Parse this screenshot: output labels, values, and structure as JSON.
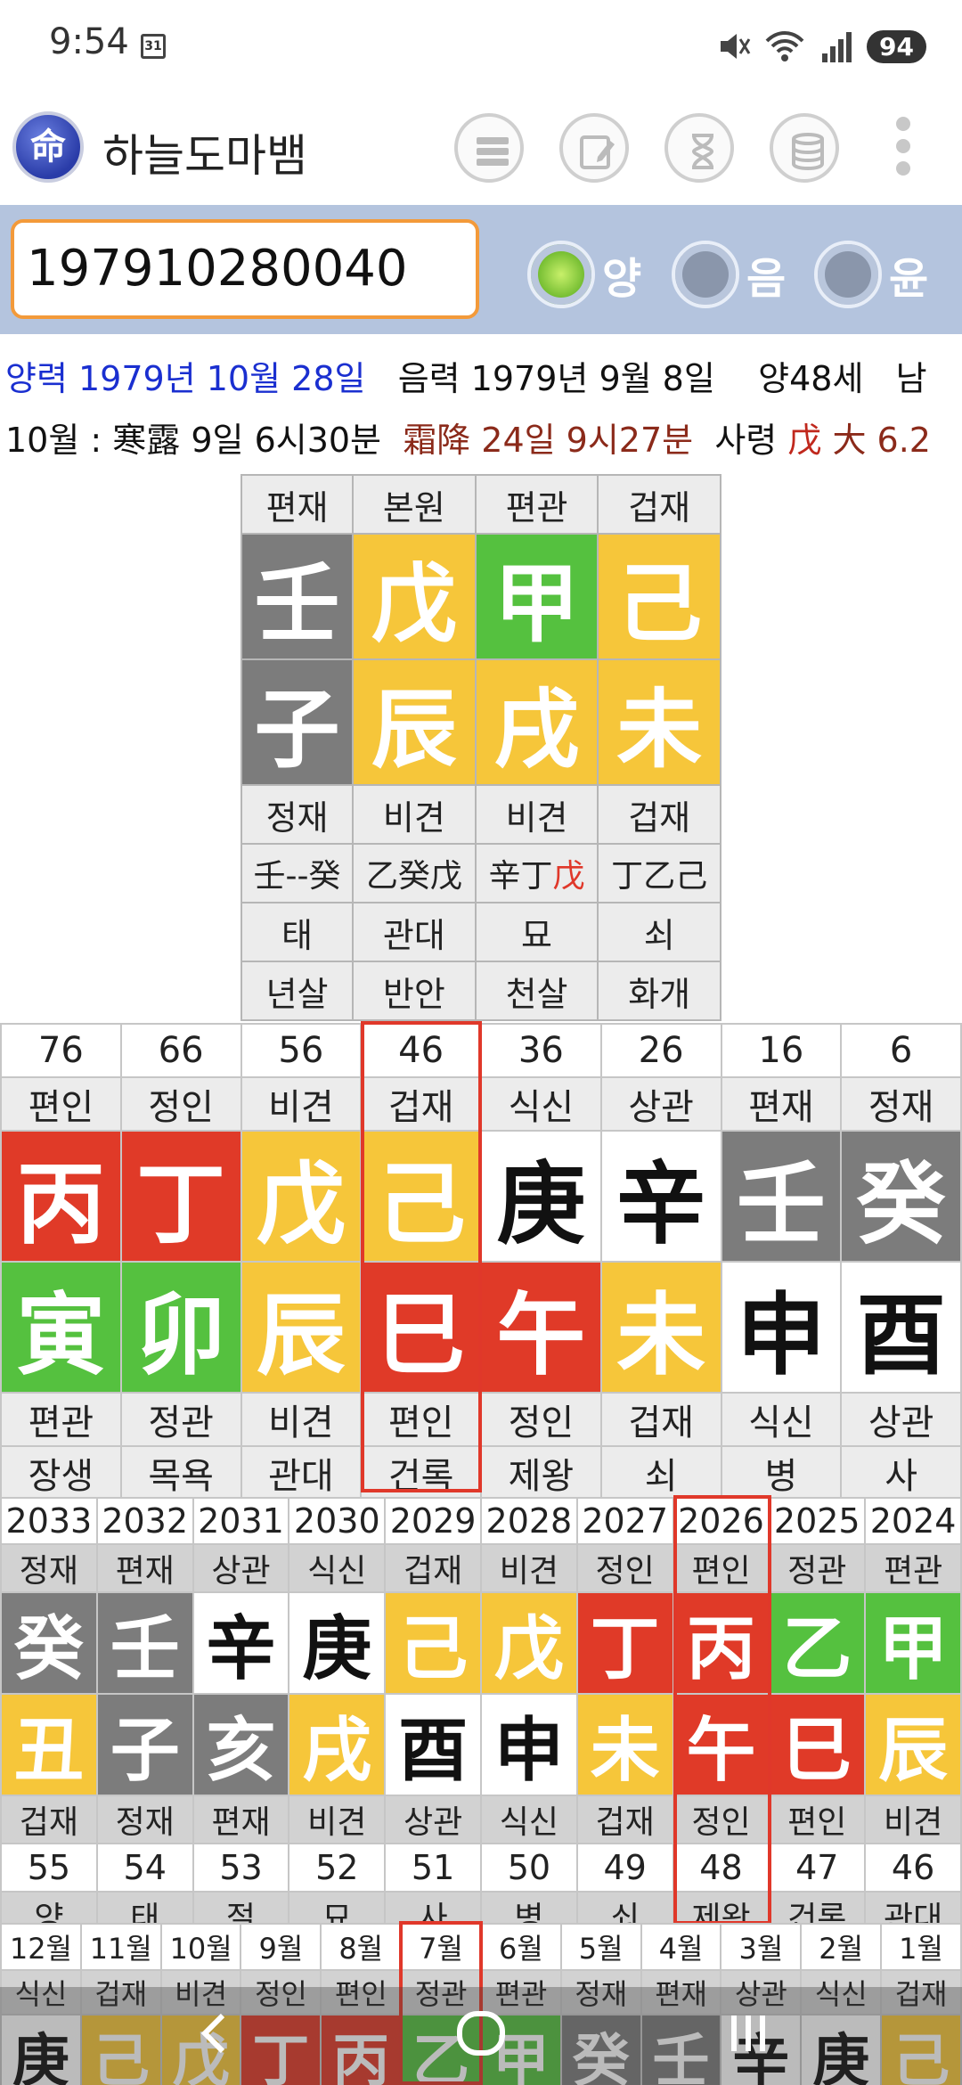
{
  "status": {
    "time": "9:54",
    "calendar_day": "31",
    "battery": "94",
    "wifi_label": "5"
  },
  "app": {
    "logo": "命",
    "title": "하늘도마뱀",
    "toolbar_icons": [
      "list-icon",
      "edit-icon",
      "hourglass-icon",
      "database-icon",
      "more-icon"
    ]
  },
  "input": {
    "value": "197910280040"
  },
  "radios": [
    {
      "label": "양",
      "selected": true
    },
    {
      "label": "음",
      "selected": false
    },
    {
      "label": "윤",
      "selected": false
    }
  ],
  "info": {
    "solar": "양력 1979년 10월 28일",
    "lunar": "음력 1979년 9월 8일",
    "age": "양48세",
    "gender": "남",
    "month_prefix": "10월 : 寒露 9일 6시30분",
    "term2": "霜降 24일 9시27분",
    "saryeong": "사령",
    "saryeong_char": "戊",
    "saryeong_big": "大",
    "saryeong_val": "6.2"
  },
  "natal": {
    "top_labels": [
      "편재",
      "본원",
      "편관",
      "겁재"
    ],
    "stems": [
      "壬",
      "戊",
      "甲",
      "己"
    ],
    "branches": [
      "子",
      "辰",
      "戌",
      "未"
    ],
    "bottom_labels": [
      "정재",
      "비견",
      "비견",
      "겁재"
    ],
    "hidden": [
      "壬--癸",
      "乙癸戊",
      "辛丁",
      "丁乙己"
    ],
    "hidden_red": "戊",
    "stage": [
      "태",
      "관대",
      "묘",
      "쇠"
    ],
    "sal": [
      "년살",
      "반안",
      "천살",
      "화개"
    ]
  },
  "daewoon": {
    "ages": [
      "76",
      "66",
      "56",
      "46",
      "36",
      "26",
      "16",
      "6"
    ],
    "top_labels": [
      "편인",
      "정인",
      "비견",
      "겁재",
      "식신",
      "상관",
      "편재",
      "정재"
    ],
    "stems": [
      "丙",
      "丁",
      "戊",
      "己",
      "庚",
      "辛",
      "壬",
      "癸"
    ],
    "branches": [
      "寅",
      "卯",
      "辰",
      "巳",
      "午",
      "未",
      "申",
      "酉"
    ],
    "bottom_labels": [
      "편관",
      "정관",
      "비견",
      "편인",
      "정인",
      "겁재",
      "식신",
      "상관"
    ],
    "stage": [
      "장생",
      "목욕",
      "관대",
      "건록",
      "제왕",
      "쇠",
      "병",
      "사"
    ]
  },
  "seun": {
    "years": [
      "2033",
      "2032",
      "2031",
      "2030",
      "2029",
      "2028",
      "2027",
      "2026",
      "2025",
      "2024"
    ],
    "top_labels": [
      "정재",
      "편재",
      "상관",
      "식신",
      "겁재",
      "비견",
      "정인",
      "편인",
      "정관",
      "편관"
    ],
    "stems": [
      "癸",
      "壬",
      "辛",
      "庚",
      "己",
      "戊",
      "丁",
      "丙",
      "乙",
      "甲"
    ],
    "branches": [
      "丑",
      "子",
      "亥",
      "戌",
      "酉",
      "申",
      "未",
      "午",
      "巳",
      "辰"
    ],
    "bottom_labels": [
      "겁재",
      "정재",
      "편재",
      "비견",
      "상관",
      "식신",
      "겁재",
      "정인",
      "편인",
      "비견"
    ],
    "ages": [
      "55",
      "54",
      "53",
      "52",
      "51",
      "50",
      "49",
      "48",
      "47",
      "46"
    ],
    "stage": [
      "양",
      "태",
      "절",
      "묘",
      "사",
      "병",
      "쇠",
      "제왕",
      "건록",
      "관대"
    ]
  },
  "wolun": {
    "months": [
      "12월",
      "11월",
      "10월",
      "9월",
      "8월",
      "7월",
      "6월",
      "5월",
      "4월",
      "3월",
      "2월",
      "1월"
    ],
    "top_labels": [
      "식신",
      "겁재",
      "비견",
      "정인",
      "편인",
      "정관",
      "편관",
      "정재",
      "편재",
      "상관",
      "식신",
      "겁재"
    ],
    "stems": [
      "庚",
      "己",
      "戊",
      "丁",
      "丙",
      "乙",
      "甲",
      "癸",
      "壬",
      "辛",
      "庚",
      "己"
    ]
  },
  "colors": {
    "gray": "#7c7c7c",
    "yellow": "#f6c63a",
    "green": "#55c13f",
    "red": "#e03a28",
    "white": "#ffffff",
    "highlight": "#e0382a",
    "input_border": "#f39a3a",
    "input_bar_bg": "#b4c4de"
  }
}
